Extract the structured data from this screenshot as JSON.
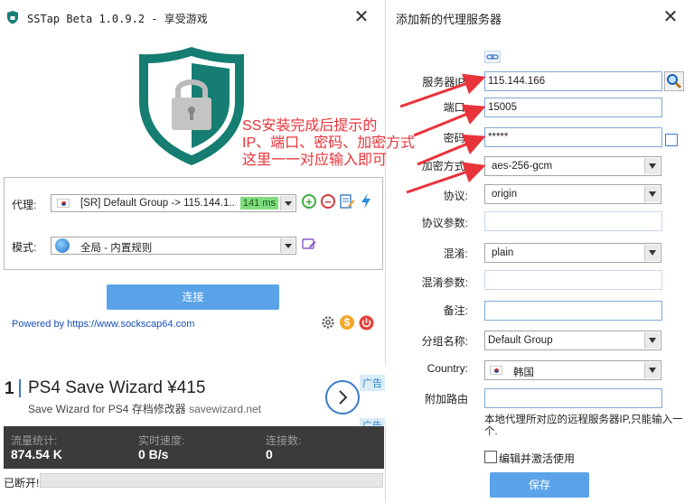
{
  "left_window": {
    "title": "SSTap Beta 1.0.9.2 - 享受游戏",
    "proxy_label": "代理:",
    "proxy_value": "[SR] Default Group -> 115.144.1...",
    "proxy_latency": "141 ms",
    "mode_label": "模式:",
    "mode_value": "全局 - 内置规则",
    "connect_label": "连接",
    "powered_by": "Powered by https://www.sockscap64.com",
    "ad": {
      "number": "1",
      "title": "PS4 Save Wizard ¥415",
      "subtitle": "Save Wizard for PS4 存档修改器",
      "domain": "savewizard.net",
      "badge": "广告",
      "badge2": "广告"
    },
    "stats": [
      {
        "header": "流量统计:",
        "value": "874.54 K"
      },
      {
        "header": "实时速度:",
        "value": "0 B/s"
      },
      {
        "header": "连接数:",
        "value": "0"
      }
    ],
    "status": "已断开!"
  },
  "right_window": {
    "title": "添加新的代理服务器",
    "fields": {
      "server_ip_label": "服务器IP:",
      "server_ip_value": "115.144.166",
      "port_label": "端口:",
      "port_value": "15005",
      "password_label": "密码:",
      "password_value": "*****",
      "cipher_label": "加密方式:",
      "cipher_value": "aes-256-gcm",
      "protocol_label": "协议:",
      "protocol_value": "origin",
      "protocol_param_label": "协议参数:",
      "protocol_param_value": "",
      "obfs_label": "混淆:",
      "obfs_value": "plain",
      "obfs_param_label": "混淆参数:",
      "obfs_param_value": "",
      "remark_label": "备注:",
      "remark_value": "",
      "group_label": "分组名称:",
      "group_value": "Default Group",
      "country_label": "Country:",
      "country_value": "韩国",
      "route_label": "附加路由",
      "route_value": ""
    },
    "route_hint": "本地代理所对应的远程服务器IP,只能输入一个.",
    "enable_label": "编辑并激活使用",
    "save_label": "保存"
  },
  "annotation": {
    "line1": "SS安装完成后提示的",
    "line2": "IP、端口、密码、加密方式",
    "line3": "这里一一对应输入即可",
    "color": "#e8333a"
  },
  "colors": {
    "accent_blue": "#5aa3e8",
    "shield_green": "#157d72",
    "stats_bg": "#3b3b3b",
    "latency_green": "#7fdc7f"
  }
}
